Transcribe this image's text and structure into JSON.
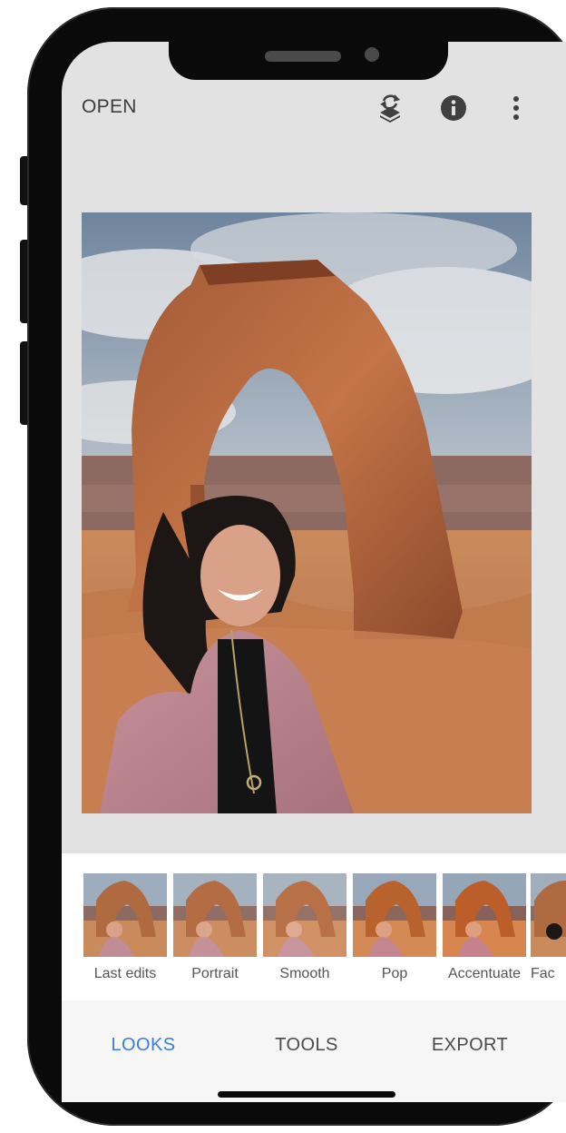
{
  "app_bar": {
    "open_label": "OPEN",
    "icons": [
      "stack-undo-icon",
      "info-icon",
      "more-vertical-icon"
    ]
  },
  "looks": {
    "items": [
      {
        "label": "Last edits"
      },
      {
        "label": "Portrait"
      },
      {
        "label": "Smooth"
      },
      {
        "label": "Pop"
      },
      {
        "label": "Accentuate"
      },
      {
        "label": "Fac"
      }
    ]
  },
  "bottom_nav": {
    "tabs": [
      {
        "label": "LOOKS",
        "active": true
      },
      {
        "label": "TOOLS",
        "active": false
      },
      {
        "label": "EXPORT",
        "active": false
      }
    ]
  },
  "colors": {
    "active_tab": "#3b7ddd",
    "inactive_tab": "#4a4a4a",
    "canvas_bg": "#e2e2e2"
  }
}
